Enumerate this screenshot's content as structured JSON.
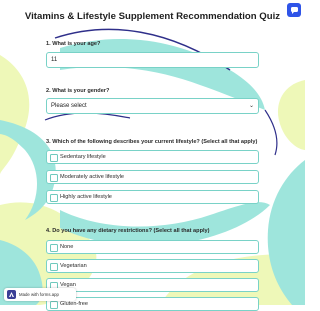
{
  "page": {
    "title": "Vitamins & Lifestyle Supplement Recommendation Quiz"
  },
  "questions": {
    "q1": {
      "label": "1. What is your age?",
      "value": "11"
    },
    "q2": {
      "label": "2. What is your gender?",
      "selected": "Please select"
    },
    "q3": {
      "label": "3. Which of the following describes your current lifestyle? (Select all that apply)",
      "options": [
        "Sedentary lifestyle",
        "Moderately active lifestyle",
        "Highly active lifestyle"
      ]
    },
    "q4": {
      "label": "4. Do you have any dietary restrictions? (Select all that apply)",
      "options": [
        "None",
        "Vegetarian",
        "Vegan",
        "Gluten-free"
      ]
    }
  },
  "badge": {
    "text": "Made with forms.app"
  },
  "icons": {
    "chat": "chat-icon",
    "caret": "chevron-down-icon",
    "logo": "forms-app-logo"
  },
  "colors": {
    "border": "#79d2c7",
    "accent_teal": "#8fe0d6",
    "accent_lime": "#e9f7a8",
    "fab": "#2f54e8"
  }
}
